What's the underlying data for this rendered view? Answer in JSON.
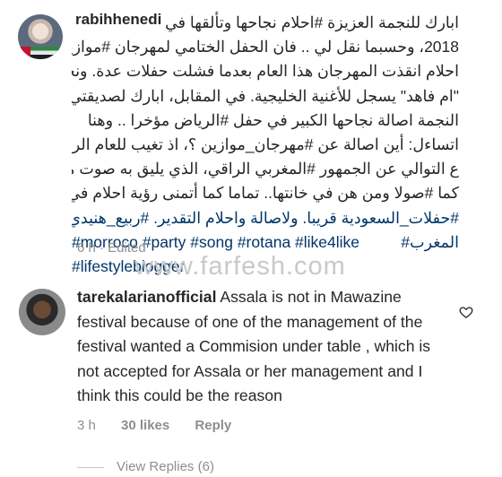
{
  "comment1": {
    "username": "rabihhenedi",
    "lines": [
      "ابارك للنجمة العزيزة #احلام نجاحها وتألقها في",
      "2018، وحسبما نقل لي .. فان الحفل الختامي لمهرجان #موازين",
      "احلام انقذت المهرجان هذا العام بعدما فشلت حفلات عدة. ونجاح",
      "\"ام فاهد\" يسجل للأغنية الخليجية. في المقابل، ابارك لصديقتي",
      "النجمة اصالة نجاحها الكبير في حفل #الرياض مؤخرا .. وهنا",
      "اتساءل: أين اصالة عن #مهرجان_موازين ؟، اذ تغيب للعام الرابع",
      "ع التوالي عن الجمهور #المغربي الراقي، الذي يليق به صوت مميز",
      "كما #صولا ومن هن في خانتها.. تماما كما أتمنى رؤية احلام في",
      "#حفلات_السعودية قريبا. ولاصالة واحلام التقدير. #ربيع_هنيدي",
      "#المغرب"
    ],
    "hashtags_en": "#morroco #party #song #rotana #like4like",
    "hashtags_en2": "#lifestyleblogger",
    "meta": "6 h · Edited"
  },
  "watermark": "www.farfesh.com",
  "comment2": {
    "username": "tarekalarianofficial",
    "text": " Assala is not in Mawazine festival because of one of  the management of the festival wanted a Commision under table , which is not accepted for Assala or her management and I think this could be the reason",
    "time": "3 h",
    "likes": "30 likes",
    "reply": "Reply",
    "view_replies": "View Replies (6)"
  },
  "colors": {
    "hashtag": "#003569",
    "meta": "#8e8e8e",
    "text": "#262626"
  }
}
